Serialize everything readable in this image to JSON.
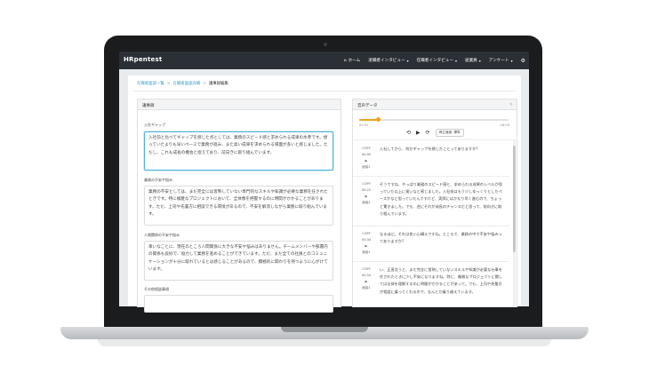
{
  "nav": {
    "brand": "HRpentest",
    "items": [
      {
        "label": "ホーム",
        "icon": "home-icon",
        "glyph": "⌂",
        "caret": ""
      },
      {
        "label": "退職者インタビュー",
        "icon": "",
        "glyph": "",
        "caret": "▾"
      },
      {
        "label": "在職者インタビュー",
        "icon": "",
        "glyph": "",
        "caret": "▾"
      },
      {
        "label": "従業員",
        "icon": "",
        "glyph": "",
        "caret": "▾"
      },
      {
        "label": "アンケート",
        "icon": "",
        "glyph": "",
        "caret": "▾"
      }
    ],
    "gear": "⚙"
  },
  "breadcrumb": {
    "item1": "在職者面談一覧",
    "item2": "在職者面談詳細",
    "current": "議事録編集",
    "sep": ">"
  },
  "left": {
    "title": "議事録",
    "sections": [
      {
        "label": "入社ギャップ",
        "text": "入社前と比べてギャップを感じた点としては、業務のスピード感と求められる成果の水準です。想っていたよりも早いペースで業務が進み、また高い成果を求められる場面が多いと感じました。ただし、これも成長の機会と捉えており、前向きに取り組んでいます。"
      },
      {
        "label": "業務の不安や悩み",
        "text": "業務の不安としては、まだ完全には習熟していない専門的なスキルや知識が必要な業務を任されたときです。特に複雑なプロジェクトにおいて、全体像を把握するのに時間がかかることがあります。ただ、上司や先輩方に相談できる環境があるので、不安を解消しながら業務に取り組んでいます。"
      },
      {
        "label": "人間関係の不安や悩み",
        "text": "幸いなことに、現在のところ人間関係に大きな不安や悩みはありません。チームメンバーや部署内の関係も良好で、協力して業務を進めることができています。ただ、まだ全ての社員とのコミュニケーションが十分に取れているとは感じることがあるので、積極的に関わりを持つように心がけています。"
      },
      {
        "label": "その他相談事項",
        "text": ""
      }
    ]
  },
  "right": {
    "title": "音声データ",
    "time_start": "00:31",
    "time_end": "-18:09",
    "progress": 0.13,
    "speed_label": "再生速度: 標準",
    "messages": [
      {
        "copy": "COPY",
        "time": "00:00 ▶",
        "speaker": "面接1",
        "text": "入社してから、何かギャップを感じたことってありますか?"
      },
      {
        "copy": "COPY",
        "time": "00:22 ▶",
        "speaker": "面接1",
        "text": "そうですね、やっぱり業務のスピード感と、求められる成果のレベルが思っていた以上に速いなと感じました。入社前はもう少しゆっくりとしたペースかなと思っていたんですけど、実際にはかなり早く進むので、ちょっと驚きました。でも、逆にそれが成長のチャンスだと思って、前向きに取り組んでいます。"
      },
      {
        "copy": "COPY",
        "time": "00:34 ▶",
        "speaker": "面接1",
        "text": "なるほど。それは良い心構えですね。ところで、業務の中で不安や悩みってありますか?"
      },
      {
        "copy": "COPY",
        "time": "00:50 ▶",
        "speaker": "面接1",
        "text": "い、正直言うと、まだ完全に習熟していないスキルや知識が必要な仕事を任されたときに少し不安になりますね。特に、複雑なプロジェクトに関しては全体を理解するのに時間がかかることがあって。でも、上司や先輩方が相談に乗ってくれるので、なんとか乗り越えています。"
      }
    ]
  }
}
